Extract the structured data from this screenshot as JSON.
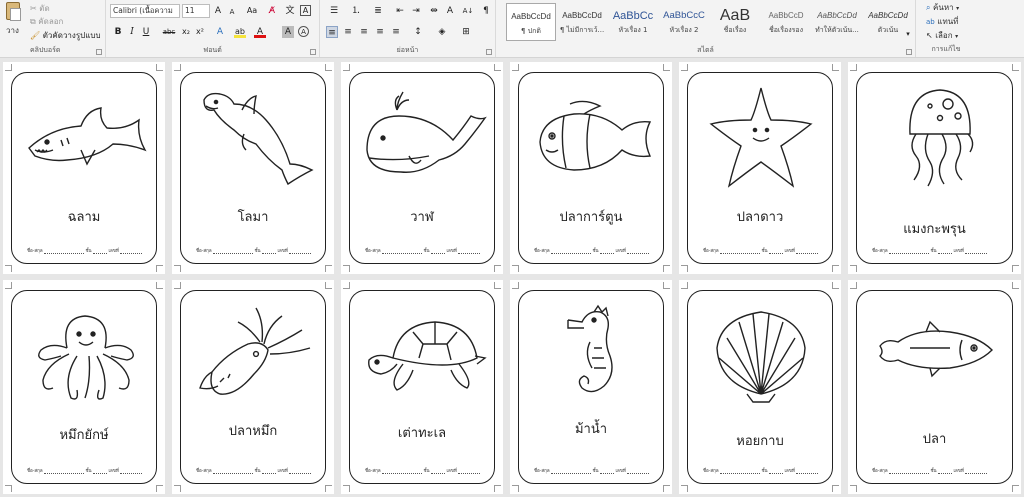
{
  "ribbon": {
    "clipboard": {
      "paste_label": "วาง",
      "cut_label": "ตัด",
      "copy_label": "คัดลอก",
      "format_painter_label": "ตัวคัดวางรูปแบบ",
      "group_label": "คลิปบอร์ด"
    },
    "font": {
      "font_name": "Calibri (เนื้อความ",
      "font_size": "11",
      "grow_label": "A",
      "shrink_label": "A",
      "case_label": "Aa",
      "bold_label": "B",
      "italic_label": "I",
      "underline_label": "U",
      "strike_label": "abc",
      "subscript_label": "x₂",
      "superscript_label": "x²",
      "text_effects_label": "A",
      "highlight_label": "ab",
      "font_color_label": "A",
      "shading_label": "A",
      "group_label": "ฟอนต์"
    },
    "paragraph": {
      "group_label": "ย่อหน้า",
      "pilcrow": "¶"
    },
    "styles": {
      "group_label": "สไตล์",
      "items": [
        {
          "sample": "AaBbCcDd",
          "name": "¶ ปกติ"
        },
        {
          "sample": "AaBbCcDd",
          "name": "¶ ไม่มีการเว้..."
        },
        {
          "sample": "AaBbCc",
          "name": "หัวเรื่อง 1"
        },
        {
          "sample": "AaBbCcC",
          "name": "หัวเรื่อง 2"
        },
        {
          "sample": "AaB",
          "name": "ชื่อเรื่อง"
        },
        {
          "sample": "AaBbCcD",
          "name": "ชื่อเรื่องรอง"
        },
        {
          "sample": "AaBbCcDd",
          "name": "ทำให้ตัวเน้น..."
        },
        {
          "sample": "AaBbCcDd",
          "name": "ตัวเน้น"
        }
      ]
    },
    "editing": {
      "find_label": "ค้นหา",
      "replace_label": "แทนที่",
      "select_label": "เลือก",
      "group_label": "การแก้ไข"
    }
  },
  "cards": [
    {
      "name": "ฉลาม"
    },
    {
      "name": "โลมา"
    },
    {
      "name": "วาฬ"
    },
    {
      "name": "ปลาการ์ตูน"
    },
    {
      "name": "ปลาดาว"
    },
    {
      "name": "แมงกะพรุน"
    },
    {
      "name": "หมึกยักษ์"
    },
    {
      "name": "ปลาหมึก"
    },
    {
      "name": "เต่าทะเล"
    },
    {
      "name": "ม้าน้ำ"
    },
    {
      "name": "หอยกาบ"
    },
    {
      "name": "ปลา"
    }
  ],
  "card_footer": {
    "name_label": "ชื่อ-สกุล",
    "class_label": "ชั้น",
    "number_label": "เลขที่"
  },
  "colors": {
    "ribbon_bg": "#f3f3f3",
    "canvas_bg": "#e6e6e6",
    "card_bg": "#ffffff",
    "line": "#222222"
  }
}
